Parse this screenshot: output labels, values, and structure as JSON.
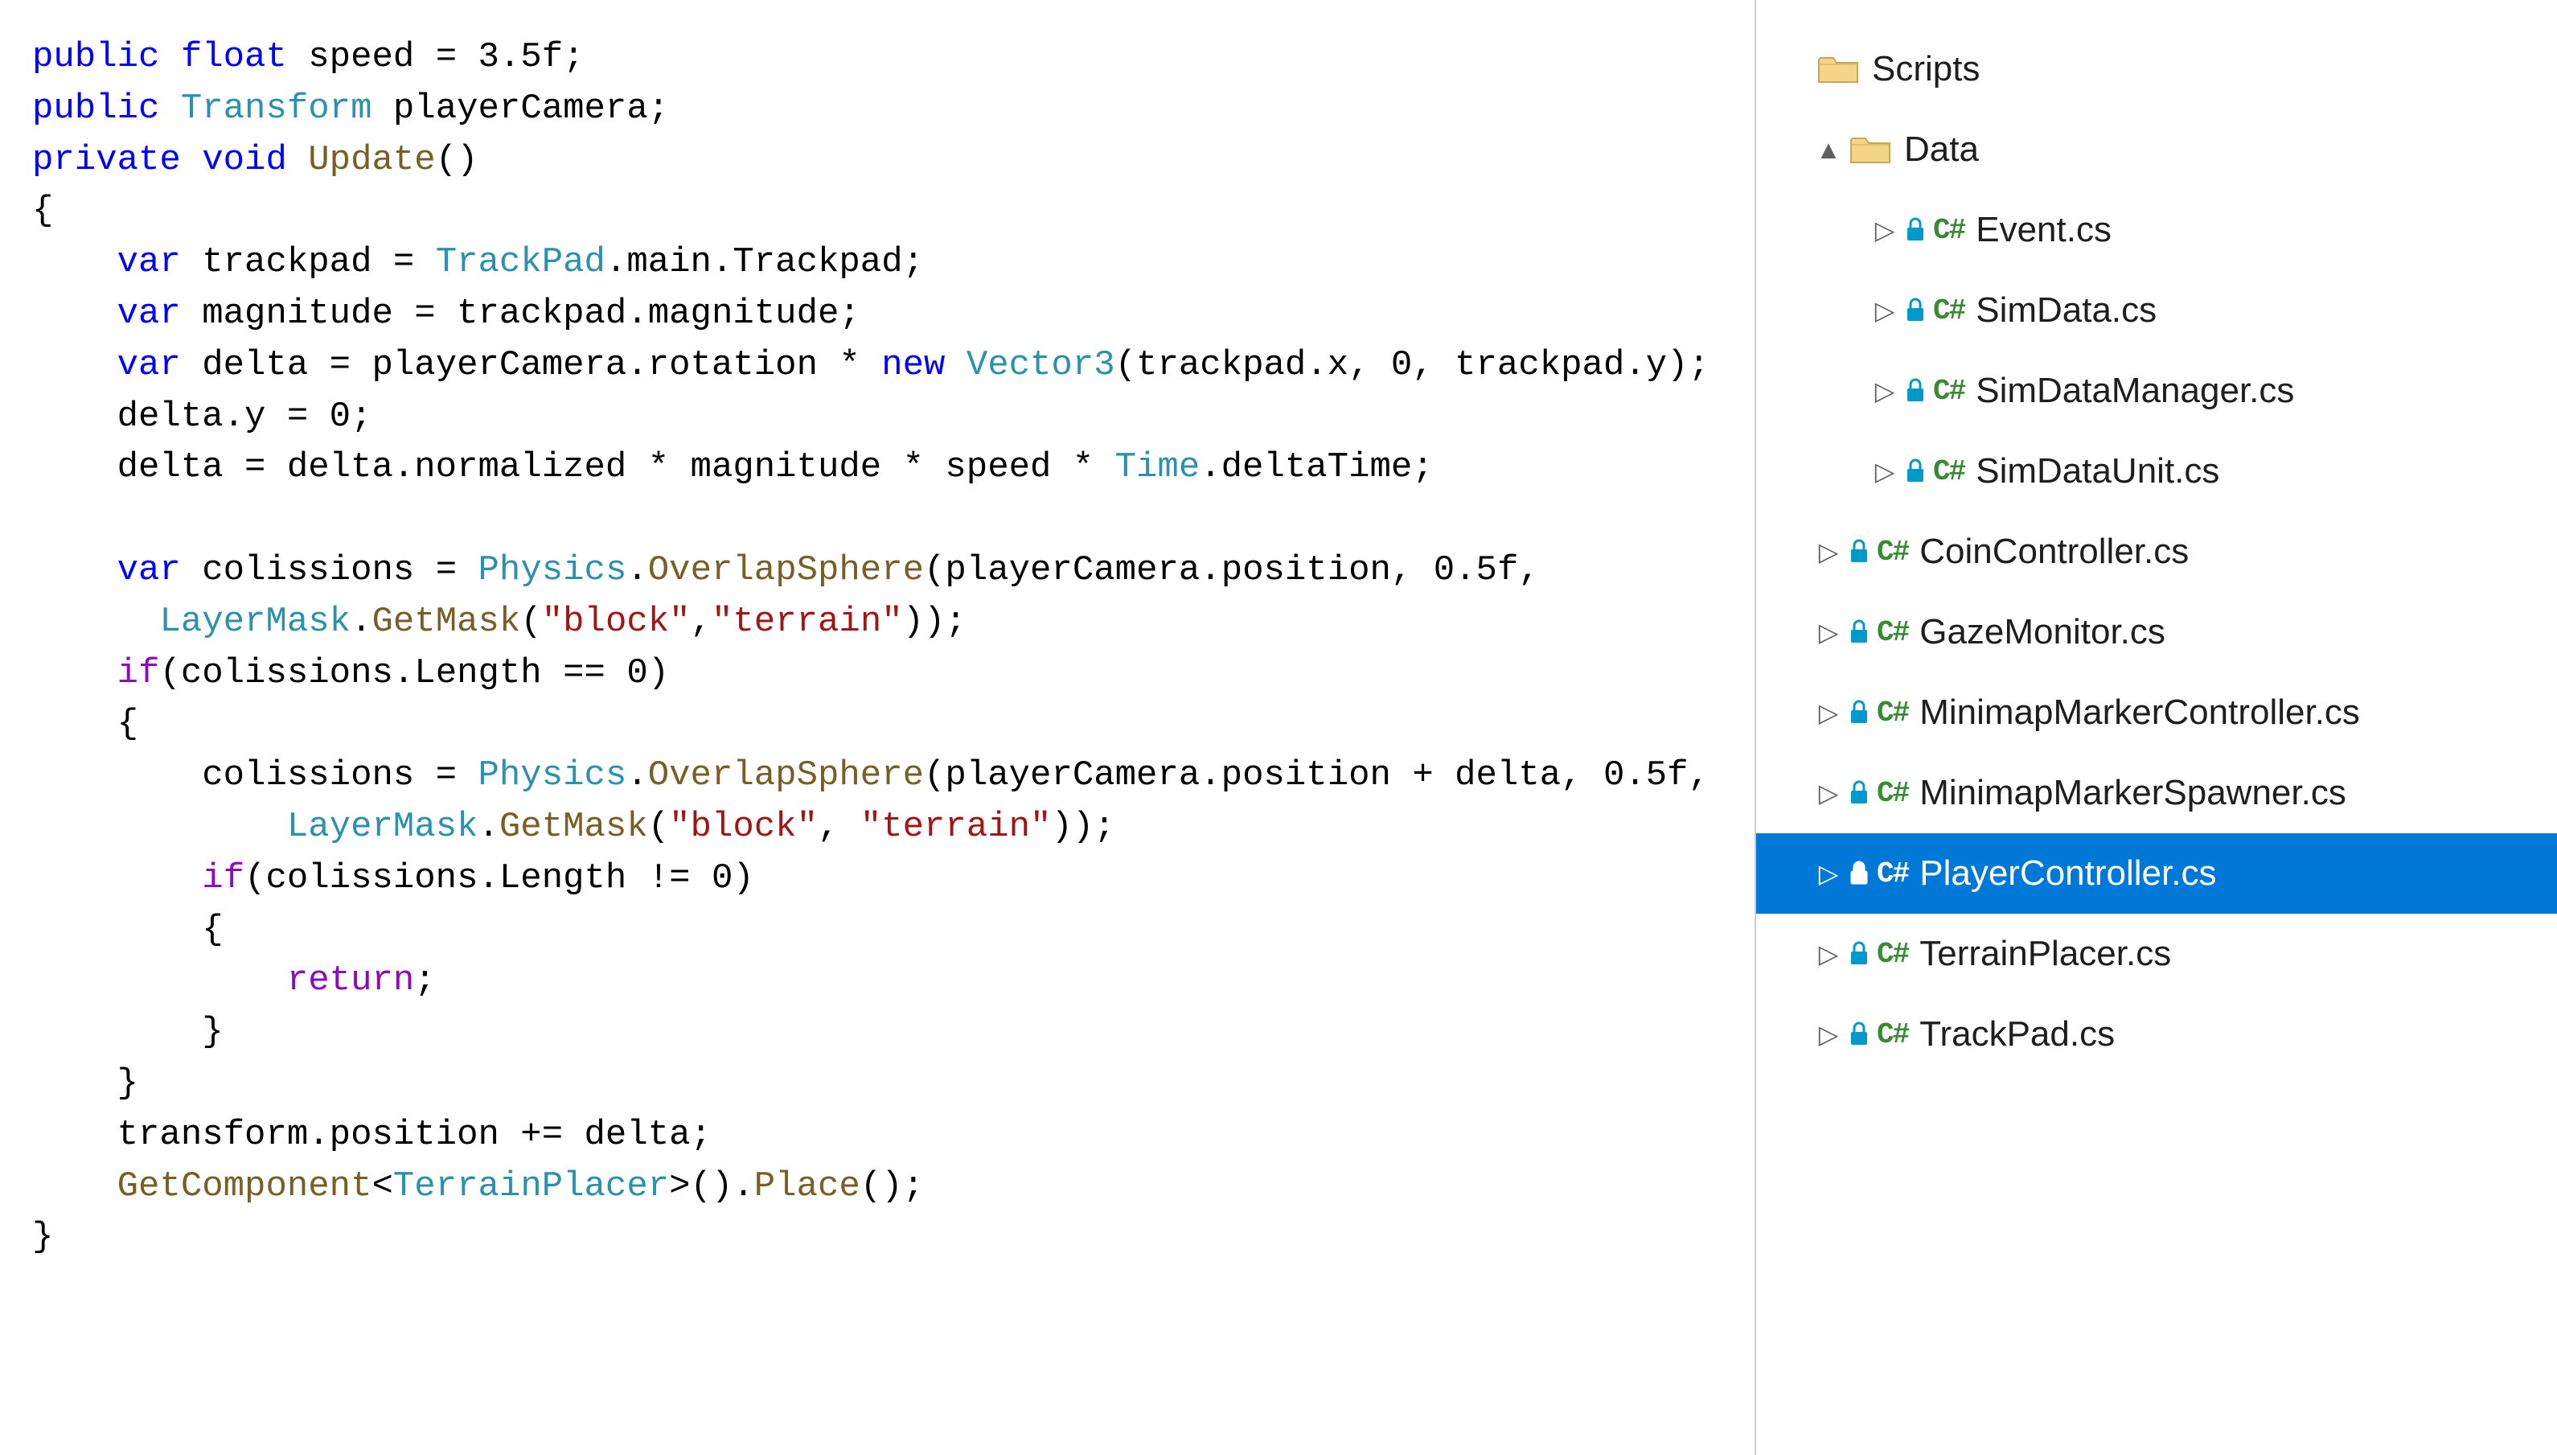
{
  "code": {
    "tokens": [
      [
        {
          "t": "public",
          "c": "c-kw"
        },
        {
          "t": " "
        },
        {
          "t": "float",
          "c": "c-kw"
        },
        {
          "t": " speed = 3.5f;"
        }
      ],
      [
        {
          "t": "public",
          "c": "c-kw"
        },
        {
          "t": " "
        },
        {
          "t": "Transform",
          "c": "c-type"
        },
        {
          "t": " playerCamera;"
        }
      ],
      [
        {
          "t": "private",
          "c": "c-kw"
        },
        {
          "t": " "
        },
        {
          "t": "void",
          "c": "c-kw"
        },
        {
          "t": " "
        },
        {
          "t": "Update",
          "c": "c-method"
        },
        {
          "t": "()"
        }
      ],
      [
        {
          "t": "{"
        }
      ],
      [
        {
          "t": "    "
        },
        {
          "t": "var",
          "c": "c-kw"
        },
        {
          "t": " trackpad = "
        },
        {
          "t": "TrackPad",
          "c": "c-type"
        },
        {
          "t": ".main.Trackpad;"
        }
      ],
      [
        {
          "t": "    "
        },
        {
          "t": "var",
          "c": "c-kw"
        },
        {
          "t": " magnitude = trackpad.magnitude;"
        }
      ],
      [
        {
          "t": "    "
        },
        {
          "t": "var",
          "c": "c-kw"
        },
        {
          "t": " delta = playerCamera.rotation * "
        },
        {
          "t": "new",
          "c": "c-kw"
        },
        {
          "t": " "
        },
        {
          "t": "Vector3",
          "c": "c-type"
        },
        {
          "t": "(trackpad.x, 0, trackpad.y);"
        }
      ],
      [
        {
          "t": "    delta.y = 0;"
        }
      ],
      [
        {
          "t": "    delta = delta.normalized * magnitude * speed * "
        },
        {
          "t": "Time",
          "c": "c-type"
        },
        {
          "t": ".deltaTime;"
        }
      ],
      [
        {
          "t": " "
        }
      ],
      [
        {
          "t": "    "
        },
        {
          "t": "var",
          "c": "c-kw"
        },
        {
          "t": " colissions = "
        },
        {
          "t": "Physics",
          "c": "c-type"
        },
        {
          "t": "."
        },
        {
          "t": "OverlapSphere",
          "c": "c-method"
        },
        {
          "t": "(playerCamera.position, 0.5f,"
        }
      ],
      [
        {
          "t": "      "
        },
        {
          "t": "LayerMask",
          "c": "c-type"
        },
        {
          "t": "."
        },
        {
          "t": "GetMask",
          "c": "c-method"
        },
        {
          "t": "("
        },
        {
          "t": "\"block\"",
          "c": "c-str"
        },
        {
          "t": ","
        },
        {
          "t": "\"terrain\"",
          "c": "c-str"
        },
        {
          "t": "));"
        }
      ],
      [
        {
          "t": "    "
        },
        {
          "t": "if",
          "c": "c-ret"
        },
        {
          "t": "(colissions.Length == 0)"
        }
      ],
      [
        {
          "t": "    {"
        }
      ],
      [
        {
          "t": "        colissions = "
        },
        {
          "t": "Physics",
          "c": "c-type"
        },
        {
          "t": "."
        },
        {
          "t": "OverlapSphere",
          "c": "c-method"
        },
        {
          "t": "(playerCamera.position + delta, 0.5f,"
        }
      ],
      [
        {
          "t": "            "
        },
        {
          "t": "LayerMask",
          "c": "c-type"
        },
        {
          "t": "."
        },
        {
          "t": "GetMask",
          "c": "c-method"
        },
        {
          "t": "("
        },
        {
          "t": "\"block\"",
          "c": "c-str"
        },
        {
          "t": ", "
        },
        {
          "t": "\"terrain\"",
          "c": "c-str"
        },
        {
          "t": "));"
        }
      ],
      [
        {
          "t": "        "
        },
        {
          "t": "if",
          "c": "c-ret"
        },
        {
          "t": "(colissions.Length != 0)"
        }
      ],
      [
        {
          "t": "        {"
        }
      ],
      [
        {
          "t": "            "
        },
        {
          "t": "return",
          "c": "c-ret"
        },
        {
          "t": ";"
        }
      ],
      [
        {
          "t": "        }"
        }
      ],
      [
        {
          "t": "    }"
        }
      ],
      [
        {
          "t": "    transform.position += delta;"
        }
      ],
      [
        {
          "t": "    "
        },
        {
          "t": "GetComponent",
          "c": "c-method"
        },
        {
          "t": "<"
        },
        {
          "t": "TerrainPlacer",
          "c": "c-type"
        },
        {
          "t": ">()."
        },
        {
          "t": "Place",
          "c": "c-method"
        },
        {
          "t": "();"
        }
      ],
      [
        {
          "t": "}"
        }
      ]
    ]
  },
  "explorer": {
    "items": [
      {
        "kind": "folder",
        "label": "Scripts",
        "indent": 0,
        "glyph": "",
        "selected": false
      },
      {
        "kind": "folder",
        "label": "Data",
        "indent": 1,
        "glyph": "▲",
        "selected": false
      },
      {
        "kind": "cs",
        "label": "Event.cs",
        "indent": 2,
        "glyph": "▷",
        "selected": false
      },
      {
        "kind": "cs",
        "label": "SimData.cs",
        "indent": 2,
        "glyph": "▷",
        "selected": false
      },
      {
        "kind": "cs",
        "label": "SimDataManager.cs",
        "indent": 2,
        "glyph": "▷",
        "selected": false
      },
      {
        "kind": "cs",
        "label": "SimDataUnit.cs",
        "indent": 2,
        "glyph": "▷",
        "selected": false
      },
      {
        "kind": "cs",
        "label": "CoinController.cs",
        "indent": 1,
        "glyph": "▷",
        "selected": false
      },
      {
        "kind": "cs",
        "label": "GazeMonitor.cs",
        "indent": 1,
        "glyph": "▷",
        "selected": false
      },
      {
        "kind": "cs",
        "label": "MinimapMarkerController.cs",
        "indent": 1,
        "glyph": "▷",
        "selected": false
      },
      {
        "kind": "cs",
        "label": "MinimapMarkerSpawner.cs",
        "indent": 1,
        "glyph": "▷",
        "selected": false
      },
      {
        "kind": "cs",
        "label": "PlayerController.cs",
        "indent": 1,
        "glyph": "▷",
        "selected": true
      },
      {
        "kind": "cs",
        "label": "TerrainPlacer.cs",
        "indent": 1,
        "glyph": "▷",
        "selected": false
      },
      {
        "kind": "cs",
        "label": "TrackPad.cs",
        "indent": 1,
        "glyph": "▷",
        "selected": false
      }
    ]
  },
  "icons": {
    "cs_badge": "C#"
  }
}
